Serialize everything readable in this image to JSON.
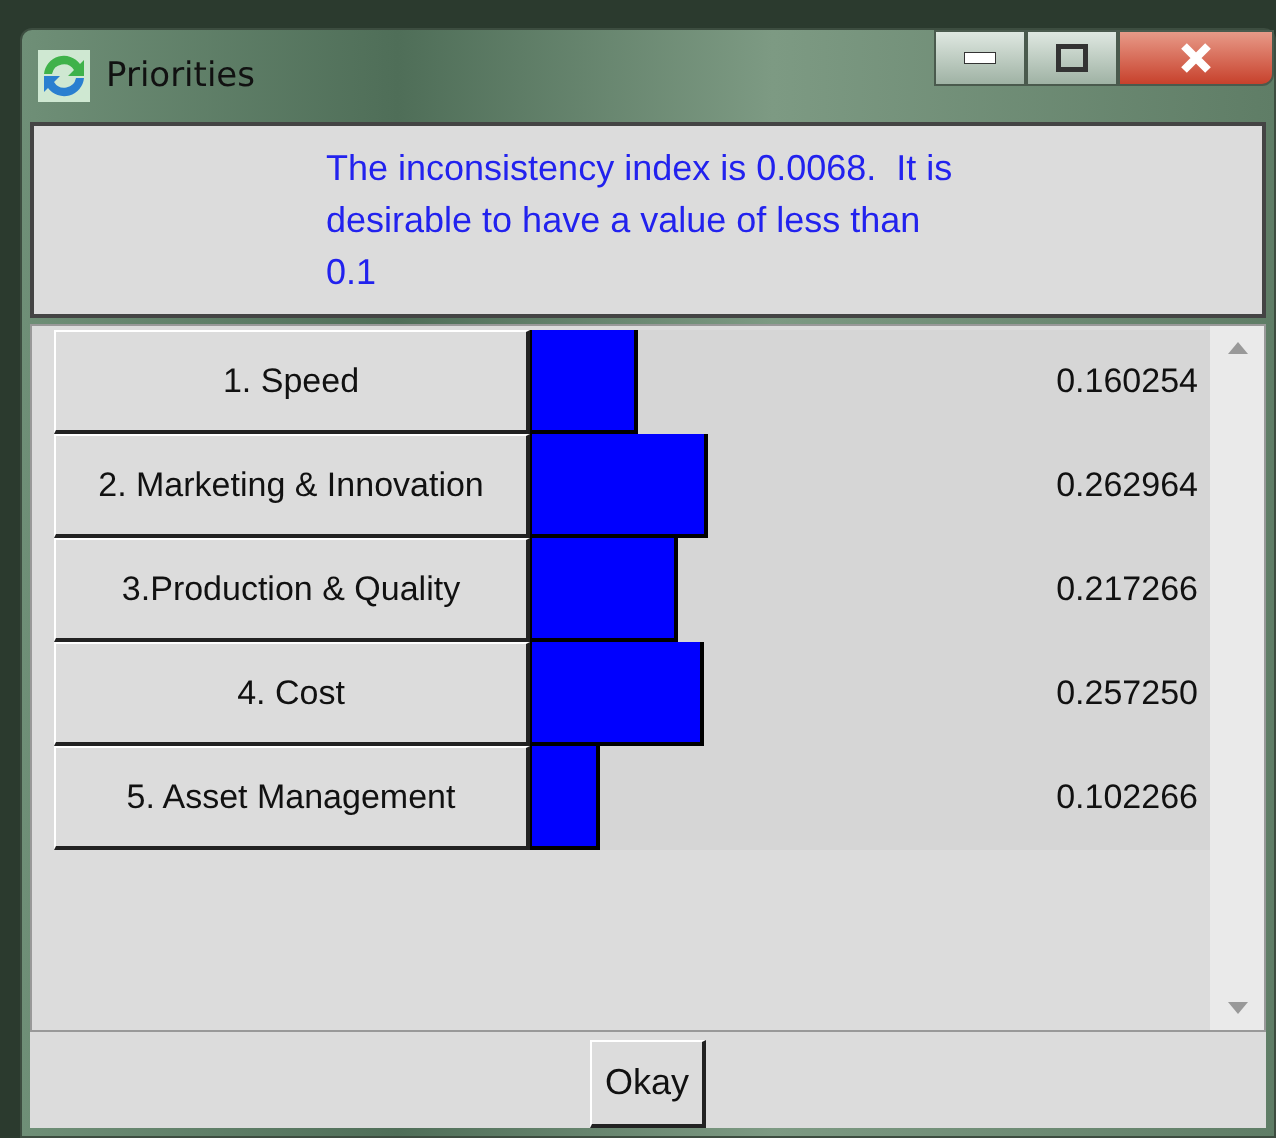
{
  "window": {
    "title": "Priorities"
  },
  "message": "The inconsistency index is 0.0068.  It is desirable to have a value of less than 0.1",
  "priorities": [
    {
      "label": "1. Speed",
      "level": 0.16,
      "reading": "0.160254"
    },
    {
      "label": "2. Marketing & Innovation",
      "level": 0.263,
      "reading": "0.262964"
    },
    {
      "label": "3.Production & Quality",
      "level": 0.217,
      "reading": "0.217266"
    },
    {
      "label": "4. Cost",
      "level": 0.257,
      "reading": "0.257250"
    },
    {
      "label": "5. Asset Management",
      "level": 0.102,
      "reading": "0.102266"
    }
  ],
  "buttons": [
    "Okay"
  ]
}
